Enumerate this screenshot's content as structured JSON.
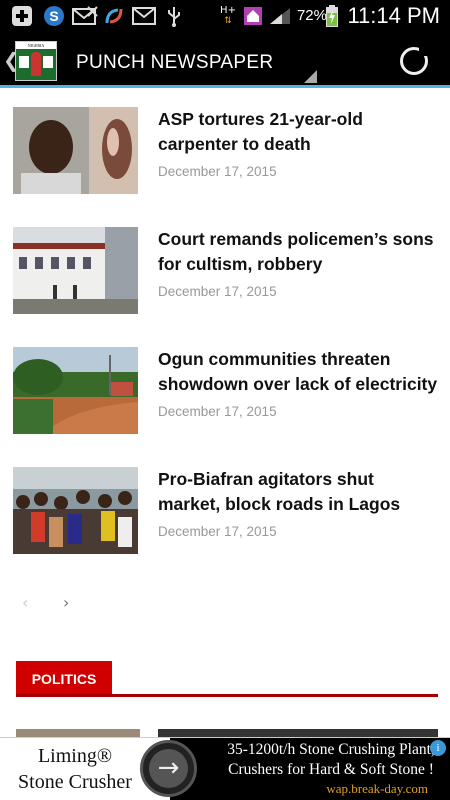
{
  "status_bar": {
    "time": "11:14 PM",
    "battery_percent": "72%",
    "network_type": "H+"
  },
  "app_bar": {
    "title": "PUNCH NEWSPAPER",
    "logo_text": "NIGERIA NEWSPAPER"
  },
  "articles": [
    {
      "headline": "ASP tortures 21-year-old carpenter to death",
      "date": "December 17, 2015"
    },
    {
      "headline": "Court remands policemen’s sons for cultism, robbery",
      "date": "December 17, 2015"
    },
    {
      "headline": "Ogun communities threaten showdown over lack of electricity",
      "date": "December 17, 2015"
    },
    {
      "headline": "Pro-Biafran agitators shut market, block roads in Lagos",
      "date": "December 17, 2015"
    }
  ],
  "pager": {
    "prev": "‹",
    "next": "›"
  },
  "section": {
    "label": "POLITICS"
  },
  "ad": {
    "left_line1": "Liming®",
    "left_line2": "Stone Crusher",
    "right_line1": "35-1200t/h Stone Crushing Plant,",
    "right_line2": "Crushers for Hard & Soft Stone !",
    "url": "wap.break-day.com",
    "info": "i"
  },
  "colors": {
    "accent": "#4fb3e8",
    "section": "#d10000"
  }
}
